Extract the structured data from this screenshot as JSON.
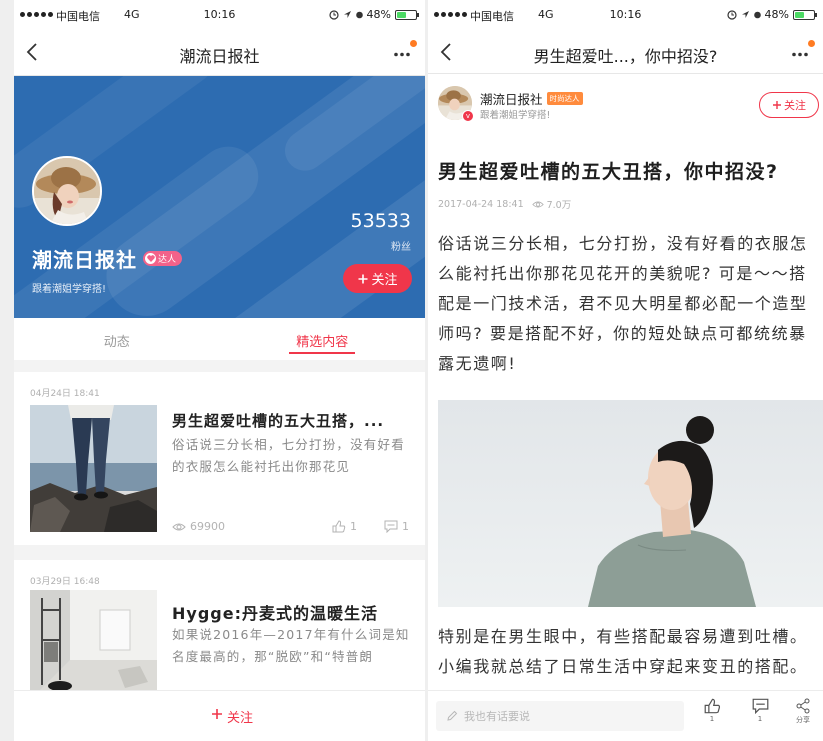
{
  "colors": {
    "accent": "#f0364a",
    "banner_blue": "#2d6cb1",
    "notification_dot": "#ff7b22"
  },
  "left_screen": {
    "status_bar": {
      "carrier": "中国电信",
      "network": "4G",
      "time": "10:16",
      "battery": "48%"
    },
    "nav": {
      "title": "潮流日报社"
    },
    "profile": {
      "name": "潮流日报社",
      "badge": "达人",
      "bio": "跟着潮姐学穿搭!",
      "fans_count": "53533",
      "fans_label": "粉丝",
      "follow_label": "关注"
    },
    "tabs": [
      {
        "label": "动态",
        "active": false
      },
      {
        "label": "精选内容",
        "active": true
      }
    ],
    "feed": [
      {
        "date": "04月24日 18:41",
        "title": "男生超爱吐槽的五大丑搭，...",
        "summary": "俗话说三分长相，七分打扮，没有好看的衣服怎么能衬托出你那花见",
        "views": "69900",
        "likes": "1",
        "comments": "1"
      },
      {
        "date": "03月29日 16:48",
        "title": "Hygge:丹麦式的温暖生活",
        "summary": "如果说2016年—2017年有什么词是知名度最高的，那“脱欧”和“特普朗"
      }
    ],
    "bottom_bar": {
      "follow_label": "关注"
    }
  },
  "right_screen": {
    "status_bar": {
      "carrier": "中国电信",
      "network": "4G",
      "time": "10:16",
      "battery": "48%"
    },
    "nav": {
      "title": "男生超爱吐...，你中招没?"
    },
    "author": {
      "name": "潮流日报社",
      "badge": "时尚达人",
      "bio": "跟着潮姐学穿搭!",
      "follow_label": "关注"
    },
    "article": {
      "title": "男生超爱吐槽的五大丑搭，你中招没?",
      "date": "2017-04-24 18:41",
      "views": "7.0万",
      "paragraphs": [
        "俗话说三分长相，七分打扮，没有好看的衣服怎么能衬托出你那花见花开的美貌呢? 可是～～搭配是一门技术活，君不见大明星都必配一个造型师吗? 要是搭配不好，你的短处缺点可都统统暴露无遗啊!",
        "特别是在男生眼中，有些搭配最容易遭到吐槽。小编我就总结了日常生活中穿起来变丑的搭配。"
      ]
    },
    "bottom_bar": {
      "comment_placeholder": "我也有话要说",
      "likes": "1",
      "comments": "1",
      "share_label": "分享"
    }
  }
}
